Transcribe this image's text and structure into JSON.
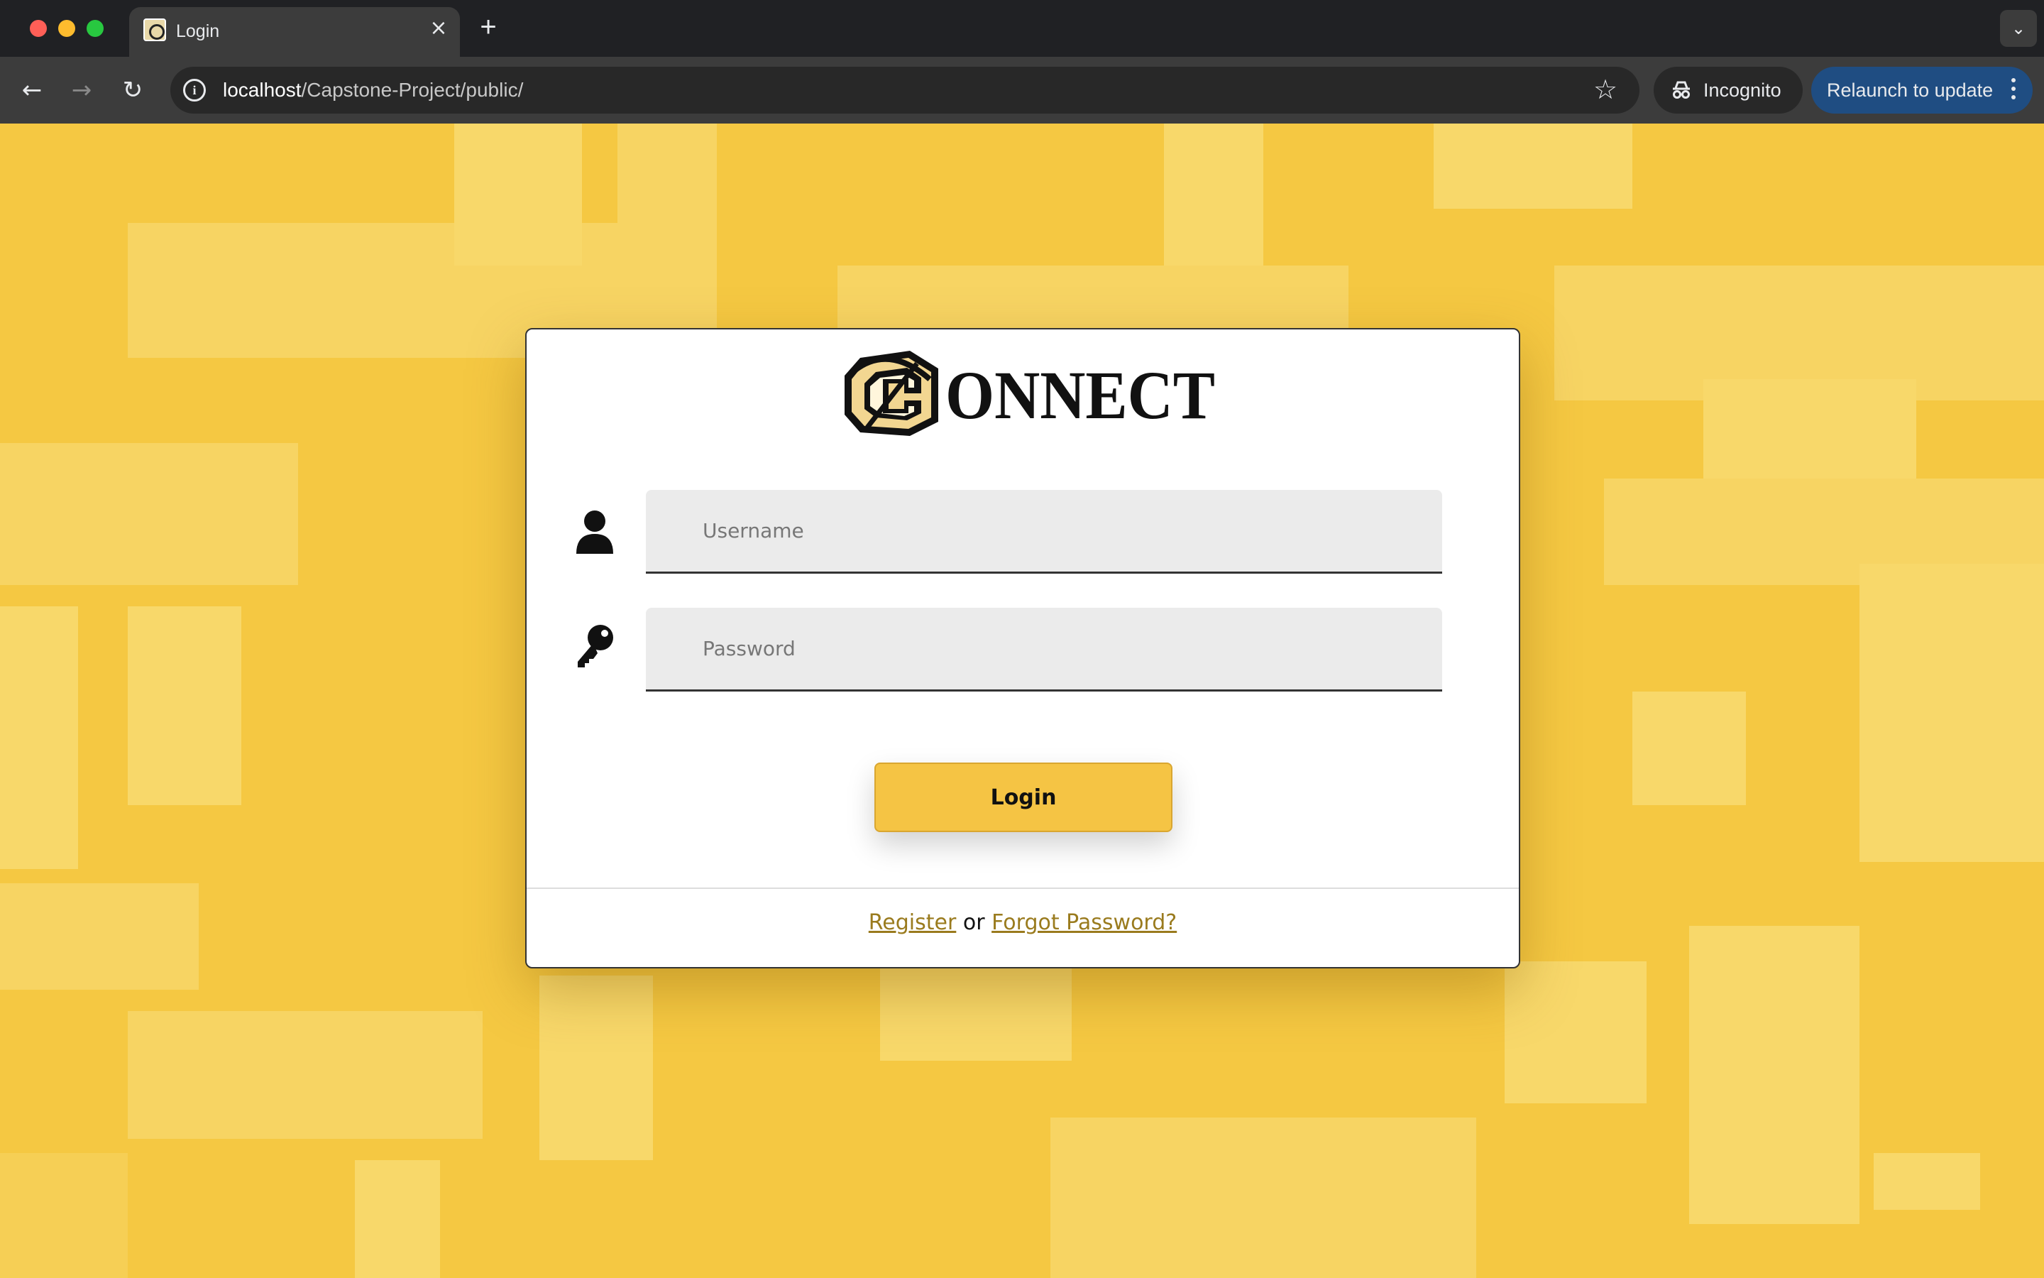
{
  "browser": {
    "tab_title": "Login",
    "url_host": "localhost",
    "url_path": "/Capstone-Project/public/",
    "incognito_label": "Incognito",
    "relaunch_label": "Relaunch to update"
  },
  "page": {
    "logo_text": "ONNECT",
    "username_placeholder": "Username",
    "password_placeholder": "Password",
    "login_label": "Login",
    "register_label": "Register",
    "or_text": "or",
    "forgot_label": "Forgot Password?"
  },
  "colors": {
    "background": "#f5c842",
    "accent": "#f5c444",
    "link": "#9a7b1e"
  }
}
